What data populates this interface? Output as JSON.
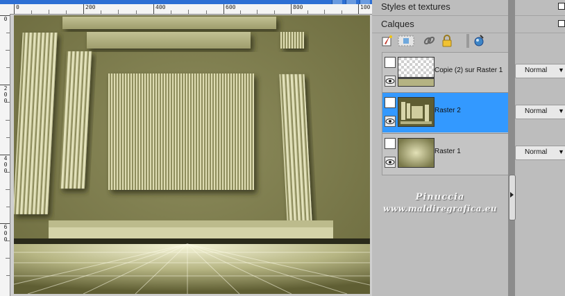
{
  "rulers": {
    "horizontal": [
      "0",
      "200",
      "400",
      "600",
      "800",
      "100"
    ],
    "vertical": [
      [
        "0"
      ],
      [
        "2",
        "0",
        "0"
      ],
      [
        "4",
        "0",
        "0"
      ],
      [
        "6",
        "0",
        "0"
      ]
    ]
  },
  "panel_top": {
    "title": "Styles et textures"
  },
  "layers_panel": {
    "title": "Calques",
    "toolbar_icons": [
      "new-raster-layer-icon",
      "layer-mask-icon",
      "link-icon",
      "lock-icon",
      "layer-properties-icon"
    ],
    "layers": [
      {
        "name": "Copie (2) sur Raster 1",
        "blend_mode": "Normal",
        "selected": false
      },
      {
        "name": "Raster 2",
        "blend_mode": "Normal",
        "selected": true
      },
      {
        "name": "Raster 1",
        "blend_mode": "Normal",
        "selected": false
      }
    ]
  },
  "watermark": {
    "line1": "Pinuccia",
    "line2": "www.maldiregrafica.eu"
  },
  "colors": {
    "selection": "#3399ff",
    "image_bg": "#7e7d4e",
    "stripe_light": "#e2e1b8",
    "stripe_dark": "#8b8a5a"
  }
}
